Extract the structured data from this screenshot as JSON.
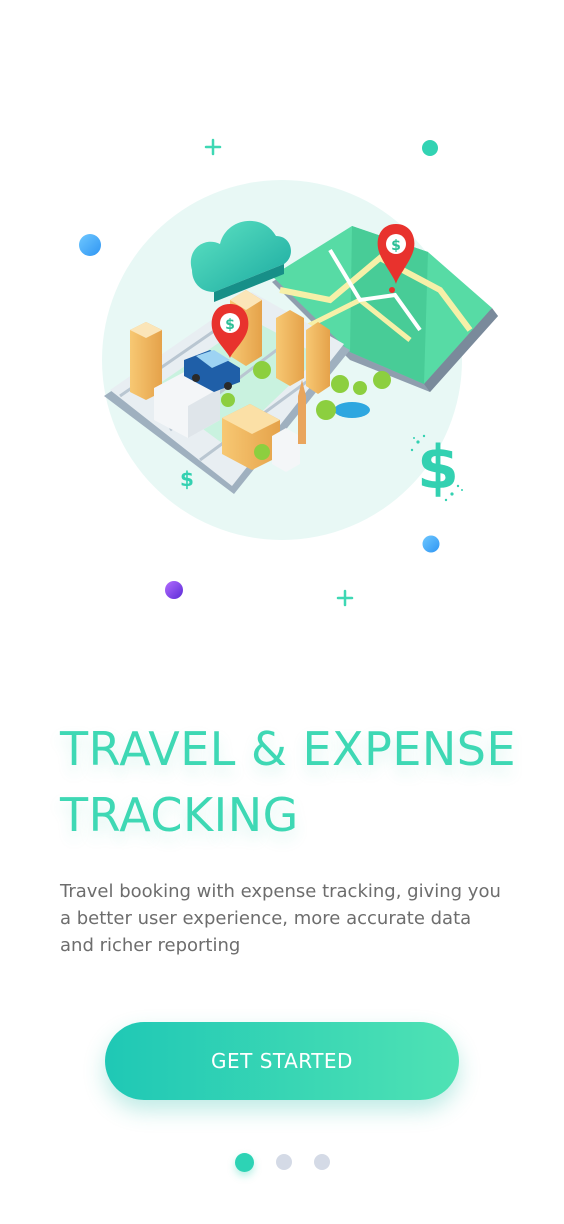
{
  "onboarding": {
    "title_line1": "TRAVEL & EXPENSE",
    "title_line2": "TRACKING",
    "description": "Travel booking with expense tracking, giving you a better user experience, more accurate data and richer reporting",
    "cta_label": "GET STARTED"
  },
  "pagination": {
    "total": 3,
    "active_index": 0
  },
  "illustration": {
    "pin_symbol": "$",
    "dollar_symbol": "$",
    "icons": [
      "cloud-icon",
      "map-icon",
      "location-pin-icon",
      "car-icon",
      "dollar-sign-icon",
      "plus-icon"
    ]
  },
  "colors": {
    "accent": "#3ed8b4",
    "button_gradient_start": "#1fc8b5",
    "button_gradient_end": "#4fe2b4",
    "pin_red": "#e8322d",
    "dot_active": "#2dd3b5",
    "dot_inactive": "#d4dae6",
    "blue_dot": "#3aaefb",
    "purple_dot": "#7a45e8"
  }
}
